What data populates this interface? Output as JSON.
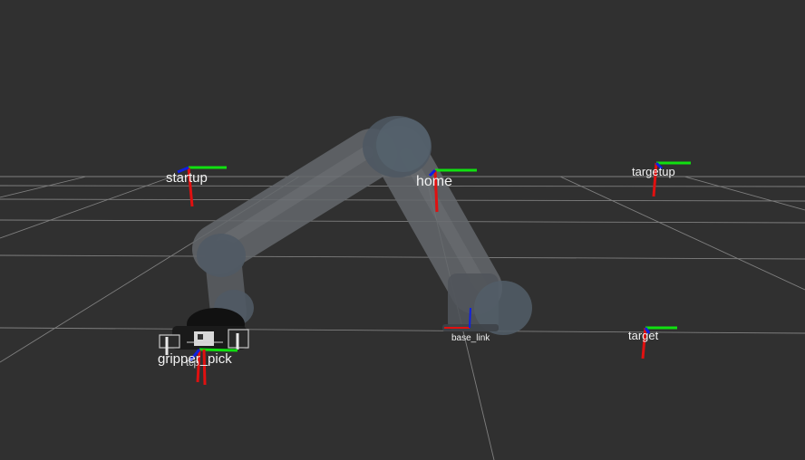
{
  "viewport": {
    "background": "#303030",
    "grid_color": "#9a9a9a"
  },
  "robot": {
    "link_color": "#6b6f73",
    "joint_color": "#56606a",
    "gripper_color": "#1a1a1a"
  },
  "axis_colors": {
    "x": "#e01010",
    "y": "#10e010",
    "z": "#1020e0"
  },
  "frames": {
    "startup": "startup",
    "home": "home",
    "targetup": "targetup",
    "target": "target",
    "base_link": "base_link",
    "gripper_pick": "gripper_pick",
    "tcp": "tcp"
  }
}
